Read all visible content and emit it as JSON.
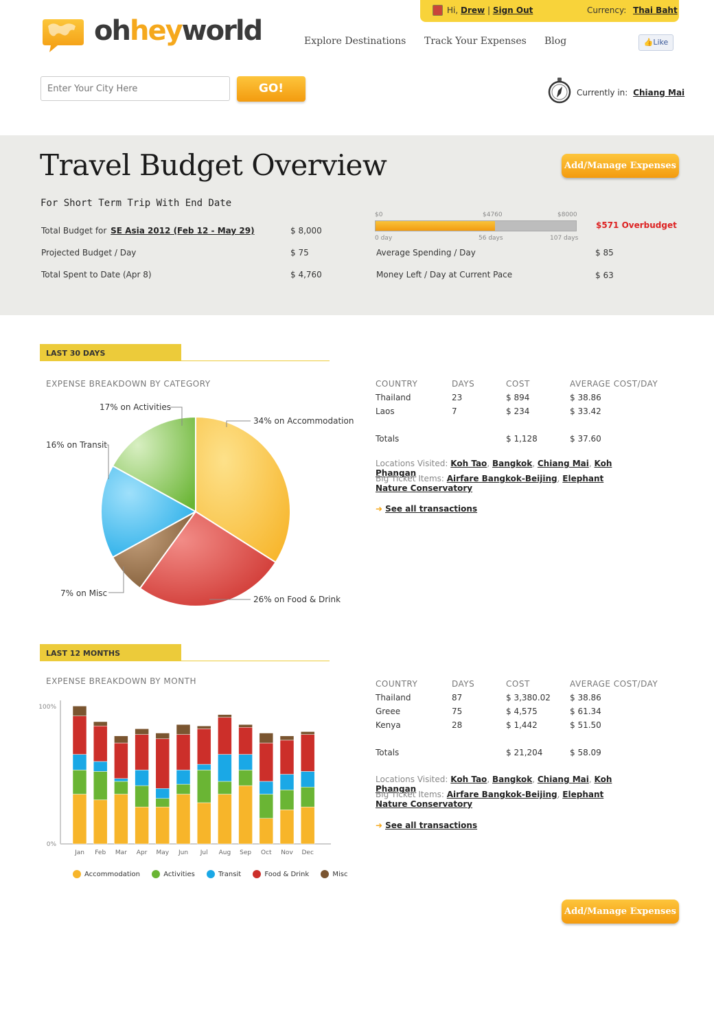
{
  "userbar": {
    "greeting": "Hi,",
    "user": "Drew",
    "sep": "|",
    "signout": "Sign Out",
    "currency_label": "Currency:",
    "currency": "Thai Baht"
  },
  "logo": {
    "part1": "oh",
    "part2": "hey",
    "part3": "world"
  },
  "nav": [
    "Explore Destinations",
    "Track Your Expenses",
    "Blog"
  ],
  "like": "Like",
  "search": {
    "placeholder": "Enter Your City Here",
    "go": "GO!"
  },
  "location": {
    "label": "Currently in:",
    "city": "Chiang Mai"
  },
  "overview": {
    "title": "Travel Budget Overview",
    "manage": "Add/Manage Expenses",
    "subtitle": "For Short Term Trip With End Date",
    "total_budget_label": "Total Budget for",
    "trip": "SE Asia 2012 (Feb 12 - May 29)",
    "total_budget": "$ 8,000",
    "projected_label": "Projected Budget / Day",
    "projected": "$ 75",
    "spent_label": "Total Spent to Date (Apr 8)",
    "spent": "$ 4,760",
    "avg_label": "Average Spending / Day",
    "avg": "$ 85",
    "left_label": "Money Left / Day at Current Pace",
    "left": "$ 63",
    "progress": {
      "fraction": 0.595,
      "top_ticks": [
        "$0",
        "$4760",
        "$8000"
      ],
      "bottom_ticks": [
        "0 day",
        "56 days",
        "107 days"
      ]
    },
    "overbudget": "$571 Overbudget"
  },
  "sec30": {
    "tab": "LAST 30 DAYS",
    "caption": "EXPENSE BREAKDOWN BY CATEGORY",
    "headers": [
      "COUNTRY",
      "DAYS",
      "COST",
      "AVERAGE COST/DAY"
    ],
    "rows": [
      [
        "Thailand",
        "23",
        "$ 894",
        "$ 38.86"
      ],
      [
        "Laos",
        "7",
        "$ 234",
        "$ 33.42"
      ]
    ],
    "totals": [
      "Totals",
      "",
      "$ 1,128",
      "$ 37.60"
    ],
    "locations_label": "Locations Visited:",
    "locations": [
      "Koh Tao",
      "Bangkok",
      "Chiang Mai",
      "Koh Phangan"
    ],
    "bigticket_label": "Big Ticket Items:",
    "bigticket": [
      "Airfare Bangkok-Beijing",
      "Elephant Nature Conservatory"
    ],
    "see_all": "See all transactions"
  },
  "sec12": {
    "tab": "LAST 12 MONTHS",
    "caption": "EXPENSE BREAKDOWN BY MONTH",
    "headers": [
      "COUNTRY",
      "DAYS",
      "COST",
      "AVERAGE COST/DAY"
    ],
    "rows": [
      [
        "Thailand",
        "87",
        "$ 3,380.02",
        "$ 38.86"
      ],
      [
        "Greee",
        "75",
        "$ 4,575",
        "$ 61.34"
      ],
      [
        "Kenya",
        "28",
        "$ 1,442",
        "$ 51.50"
      ]
    ],
    "totals": [
      "Totals",
      "",
      "$ 21,204",
      "$ 58.09"
    ],
    "locations_label": "Locations Visited:",
    "locations": [
      "Koh Tao",
      "Bangkok",
      "Chiang Mai",
      "Koh Phangan"
    ],
    "bigticket_label": "Big Ticket Items:",
    "bigticket": [
      "Airfare Bangkok-Beijing",
      "Elephant Nature Conservatory"
    ],
    "see_all": "See all transactions"
  },
  "manage_bottom": "Add/Manage Expenses",
  "colors": {
    "accommodation": "#f7b52a",
    "activities": "#6ab534",
    "transit": "#1aa8e6",
    "food": "#cc2f2a",
    "misc": "#7a5530",
    "accent": "#f5a81c",
    "band": "#eccb3a"
  },
  "chart_data": [
    {
      "type": "pie",
      "labels": [
        "17% on Activities",
        "34% on Accommodation",
        "16% on Transit",
        "7% on Misc",
        "26% on Food & Drink"
      ],
      "categories": [
        "Accommodation",
        "Food & Drink",
        "Misc",
        "Transit",
        "Activities"
      ],
      "values": [
        34,
        26,
        7,
        16,
        17
      ]
    },
    {
      "type": "bar",
      "stacked": true,
      "categories": [
        "Jan",
        "Feb",
        "Mar",
        "Apr",
        "May",
        "Jun",
        "Jul",
        "Aug",
        "Sep",
        "Oct",
        "Nov",
        "Dec"
      ],
      "ylim": [
        0,
        100
      ],
      "yticks": [
        "0%",
        "100%"
      ],
      "series": [
        {
          "name": "Accommodation",
          "values": [
            35,
            31,
            35,
            26,
            26,
            35,
            29,
            35,
            41,
            18,
            24,
            26
          ]
        },
        {
          "name": "Activities",
          "values": [
            17,
            20,
            9,
            15,
            6,
            7,
            23,
            9,
            11,
            17,
            14,
            14
          ]
        },
        {
          "name": "Transit",
          "values": [
            11,
            7,
            2,
            11,
            7,
            10,
            4,
            19,
            11,
            9,
            11,
            11
          ]
        },
        {
          "name": "Food & Drink",
          "values": [
            27,
            25,
            25,
            25,
            35,
            25,
            25,
            26,
            19,
            27,
            24,
            26
          ]
        },
        {
          "name": "Misc",
          "values": [
            7,
            3,
            5,
            4,
            4,
            7,
            2,
            2,
            2,
            7,
            3,
            2
          ]
        }
      ]
    }
  ]
}
